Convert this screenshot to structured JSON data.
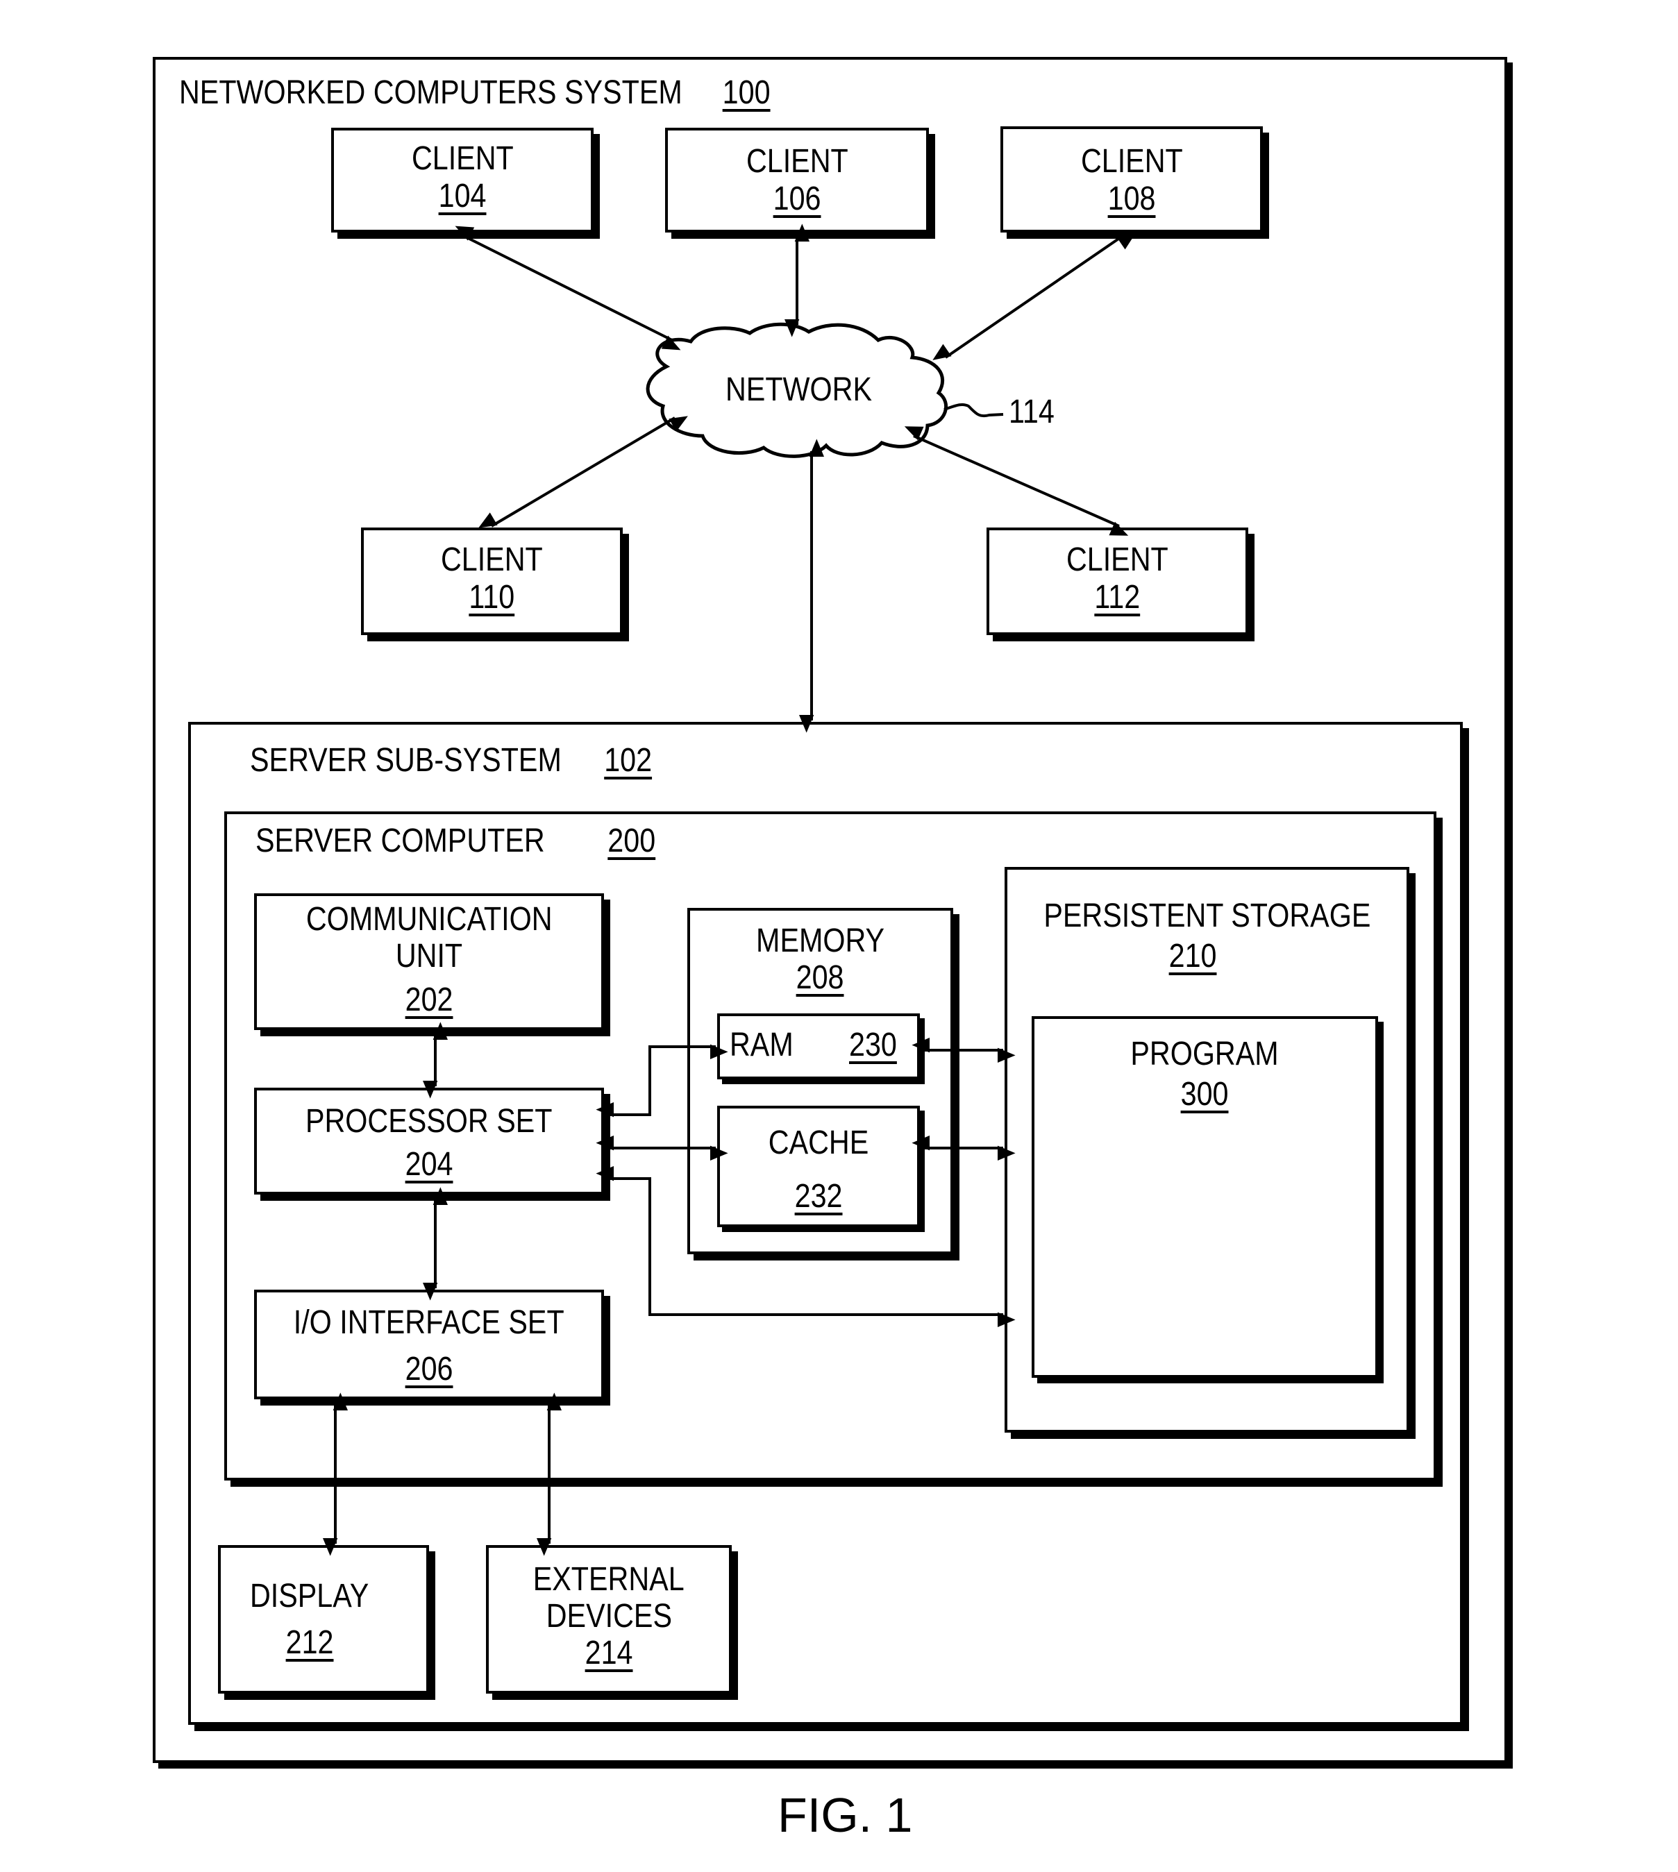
{
  "figure": {
    "caption": "FIG. 1",
    "system": {
      "title": "NETWORKED COMPUTERS SYSTEM",
      "ref": "100"
    },
    "clients": [
      {
        "label": "CLIENT",
        "ref": "104"
      },
      {
        "label": "CLIENT",
        "ref": "106"
      },
      {
        "label": "CLIENT",
        "ref": "108"
      },
      {
        "label": "CLIENT",
        "ref": "110"
      },
      {
        "label": "CLIENT",
        "ref": "112"
      }
    ],
    "network": {
      "label": "NETWORK",
      "ref": "114"
    },
    "server_subsystem": {
      "title": "SERVER SUB-SYSTEM",
      "ref": "102"
    },
    "server_computer": {
      "title": "SERVER COMPUTER",
      "ref": "200"
    },
    "communication_unit": {
      "line1": "COMMUNICATION",
      "line2": "UNIT",
      "ref": "202"
    },
    "processor_set": {
      "label": "PROCESSOR SET",
      "ref": "204"
    },
    "io_interface_set": {
      "label": "I/O INTERFACE SET",
      "ref": "206"
    },
    "memory": {
      "label": "MEMORY",
      "ref": "208"
    },
    "ram": {
      "label": "RAM",
      "ref": "230"
    },
    "cache": {
      "label": "CACHE",
      "ref": "232"
    },
    "persistent_storage": {
      "label": "PERSISTENT STORAGE",
      "ref": "210"
    },
    "program": {
      "label": "PROGRAM",
      "ref": "300"
    },
    "display": {
      "label": "DISPLAY",
      "ref": "212"
    },
    "external_devices": {
      "line1": "EXTERNAL",
      "line2": "DEVICES",
      "ref": "214"
    }
  }
}
